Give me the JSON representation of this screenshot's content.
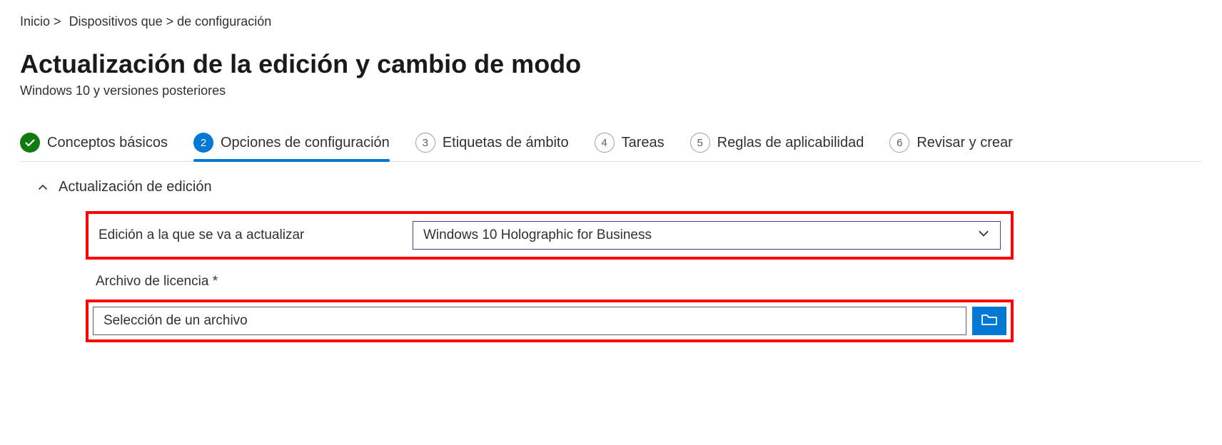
{
  "breadcrumb": {
    "items": [
      "Inicio >",
      "Dispositivos que > de configuración"
    ]
  },
  "header": {
    "title": "Actualización de la edición y cambio de modo",
    "subtitle": "Windows 10 y versiones posteriores"
  },
  "wizard": {
    "steps": [
      {
        "label": "Conceptos básicos",
        "state": "done",
        "num": ""
      },
      {
        "label": "Opciones de configuración",
        "state": "current",
        "num": "2"
      },
      {
        "label": "Etiquetas de ámbito",
        "state": "upcoming",
        "num": "3"
      },
      {
        "label": "Tareas",
        "state": "upcoming",
        "num": "4"
      },
      {
        "label": "Reglas de aplicabilidad",
        "state": "upcoming",
        "num": "5"
      },
      {
        "label": "Revisar y crear",
        "state": "upcoming",
        "num": "6"
      }
    ]
  },
  "section": {
    "title": "Actualización de edición",
    "edition_field_label": "Edición a la que se va a actualizar",
    "edition_value": "Windows 10 Holographic for Business",
    "license_label": "Archivo de licencia *",
    "file_placeholder": "Selección de un archivo"
  },
  "icons": {
    "checkmark": "✓"
  }
}
